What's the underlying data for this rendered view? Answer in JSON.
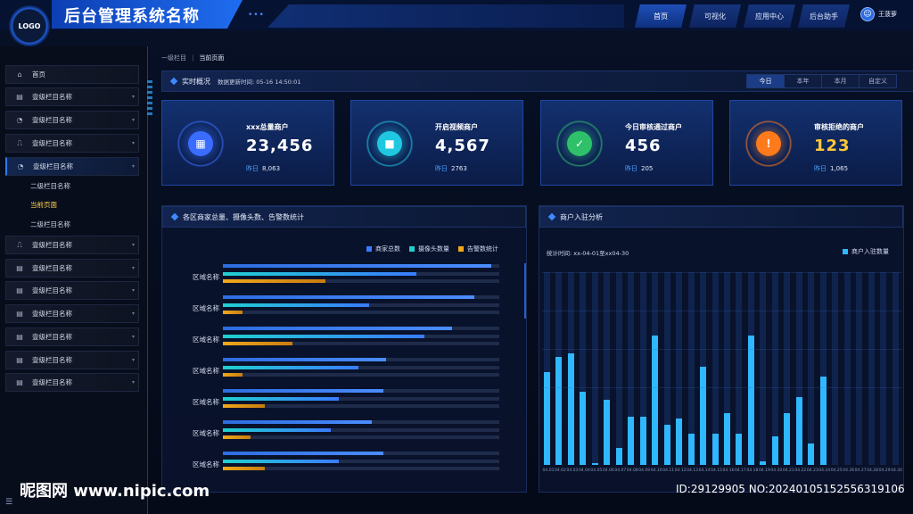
{
  "header": {
    "logo": "LOGO",
    "title": "后台管理系统名称",
    "dots": "•••",
    "nav": [
      "首页",
      "可视化",
      "应用中心",
      "后台助手"
    ],
    "user": "王菠萝"
  },
  "sidebar": {
    "items": [
      {
        "label": "首页",
        "icon": "⌂"
      },
      {
        "label": "壹级栏目名称",
        "icon": "▤"
      },
      {
        "label": "壹级栏目名称",
        "icon": "◔"
      },
      {
        "label": "壹级栏目名称",
        "icon": "⎍"
      },
      {
        "label": "壹级栏目名称",
        "icon": "◔"
      },
      {
        "label": "壹级栏目名称",
        "icon": "⎍"
      },
      {
        "label": "壹级栏目名称",
        "icon": "▤"
      },
      {
        "label": "壹级栏目名称",
        "icon": "▤"
      },
      {
        "label": "壹级栏目名称",
        "icon": "▤"
      },
      {
        "label": "壹级栏目名称",
        "icon": "▤"
      },
      {
        "label": "壹级栏目名称",
        "icon": "▤"
      },
      {
        "label": "壹级栏目名称",
        "icon": "▤"
      }
    ],
    "subitems": [
      "二级栏目名称",
      "当前页面",
      "二级栏目名称"
    ]
  },
  "breadcrumb": {
    "level1": "一级栏目",
    "current": "当前页面"
  },
  "overview": {
    "title": "实时概况",
    "update": "数据更新时间: 05-16 14:50:01",
    "tabs": [
      "今日",
      "本年",
      "本月",
      "自定义"
    ]
  },
  "cards": [
    {
      "label": "xxx总量商户",
      "value": "23,456",
      "yd_label": "昨日",
      "yd_value": "8,063",
      "color": "#3a6dff",
      "icon": "▦"
    },
    {
      "label": "开启视频商户",
      "value": "4,567",
      "yd_label": "昨日",
      "yd_value": "2763",
      "color": "#1fc8e0",
      "icon": "■"
    },
    {
      "label": "今日审核通过商户",
      "value": "456",
      "yd_label": "昨日",
      "yd_value": "205",
      "color": "#2fc16a",
      "icon": "✓"
    },
    {
      "label": "审核拒绝的商户",
      "value": "123",
      "yd_label": "昨日",
      "yd_value": "1,065",
      "color": "#ff7a1a",
      "icon": "!"
    }
  ],
  "left_panel": {
    "title": "各区商家总量、摄像头数、告警数统计",
    "legend": [
      "商家总数",
      "摄像头数量",
      "告警数统计"
    ],
    "colors": [
      "#3a7bff",
      "#20d0d0",
      "#f0a81c"
    ],
    "regions": [
      "区域名称",
      "区域名称",
      "区域名称",
      "区域名称",
      "区域名称",
      "区域名称",
      "区域名称"
    ],
    "values": [
      [
        0.97,
        0.7,
        0.37
      ],
      [
        0.91,
        0.53,
        0.07
      ],
      [
        0.83,
        0.73,
        0.25
      ],
      [
        0.59,
        0.49,
        0.07
      ],
      [
        0.58,
        0.42,
        0.15
      ],
      [
        0.54,
        0.39,
        0.1
      ],
      [
        0.58,
        0.42,
        0.15
      ]
    ]
  },
  "chart_data": {
    "type": "bar",
    "title": "商户入驻分析",
    "subtitle": "统计时间: xx-04-01至xx04-30",
    "legend": [
      "商户入驻数量"
    ],
    "categories": [
      "04.01",
      "04.02",
      "04.03",
      "04.04",
      "04.05",
      "04.06",
      "04.07",
      "04.08",
      "04.09",
      "04.10",
      "04.11",
      "04.12",
      "04.13",
      "04.14",
      "04.15",
      "04.16",
      "04.17",
      "04.18",
      "04.19",
      "04.20",
      "04.21",
      "04.22",
      "04.23",
      "04.24",
      "04.25",
      "04.26",
      "04.27",
      "04.28",
      "04.29",
      "04.30"
    ],
    "values": [
      48,
      56,
      58,
      38,
      1,
      34,
      9,
      25,
      25,
      67,
      21,
      24,
      16,
      51,
      16,
      27,
      16,
      67,
      2,
      15,
      27,
      35,
      11,
      46,
      0,
      0,
      0,
      0,
      0,
      0
    ],
    "ylim": [
      0,
      100
    ]
  },
  "watermark": {
    "left": "昵图网 www.nipic.com",
    "right": "ID:29129905 NO:20240105152556319106"
  }
}
